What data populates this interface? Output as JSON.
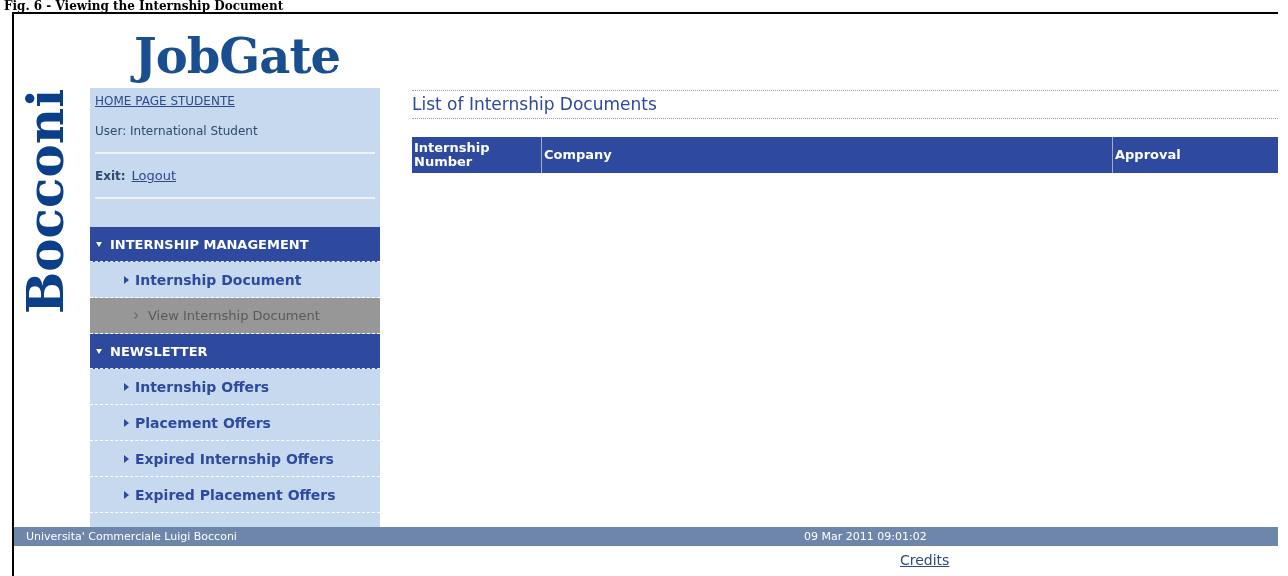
{
  "caption": "Fig. 6 - Viewing the Internship Document",
  "logo": "JobGate",
  "side_logo": "Bocconi",
  "user_panel": {
    "home_link": "HOME PAGE STUDENTE",
    "user": "User: International Student",
    "exit_label": "Exit:",
    "logout_link": "Logout"
  },
  "menu": [
    {
      "title": "INTERNSHIP MANAGEMENT",
      "expanded": true,
      "items": [
        {
          "label": "Internship Document",
          "selected": false,
          "children": [
            {
              "label": "View Internship Document",
              "selected": true
            }
          ]
        }
      ]
    },
    {
      "title": "NEWSLETTER",
      "expanded": true,
      "items": [
        {
          "label": "Internship Offers",
          "selected": false
        },
        {
          "label": "Placement Offers",
          "selected": false
        },
        {
          "label": "Expired Internship Offers",
          "selected": false
        },
        {
          "label": "Expired Placement Offers",
          "selected": false
        }
      ]
    }
  ],
  "content": {
    "title": "List of Internship Documents",
    "table": {
      "columns": [
        "Internship Number",
        "Company",
        "Approval"
      ]
    }
  },
  "footer": {
    "left": "Universita' Commerciale Luigi Bocconi",
    "datetime": "09 Mar 2011 09:01:02",
    "credits_link": "Credits"
  }
}
